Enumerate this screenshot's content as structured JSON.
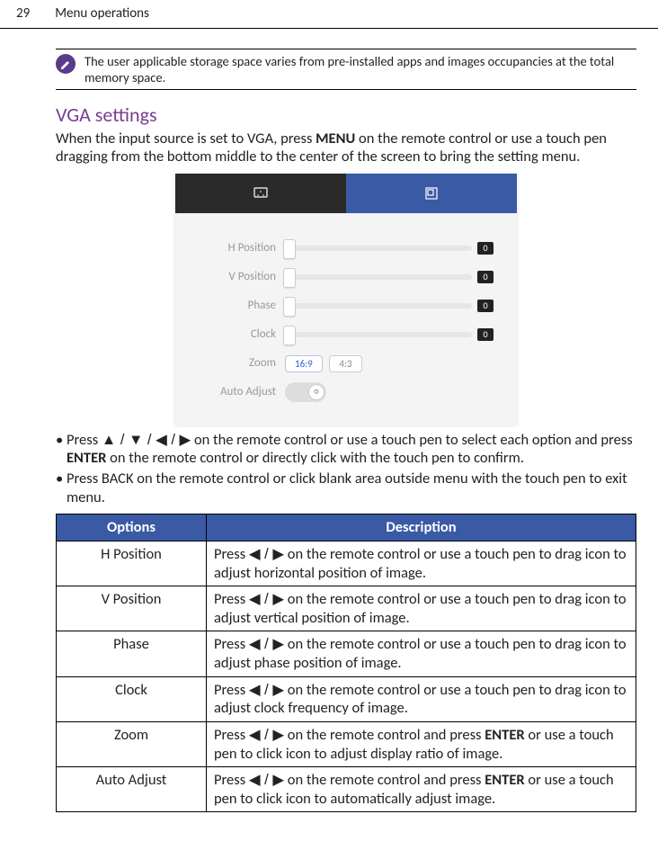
{
  "header": {
    "page_number": "29",
    "title": "Menu operations"
  },
  "note": {
    "text": "The user applicable storage space varies from pre-installed apps and images occupancies at the total memory space."
  },
  "section": {
    "title": "VGA settings",
    "intro_a": "When the input source is set to VGA, press ",
    "intro_menu": "MENU",
    "intro_b": " on the remote control or use a touch pen dragging from the bottom middle to the center of the screen to bring the setting menu."
  },
  "figure": {
    "rows": {
      "h_position": {
        "label": "H Position",
        "value": "0"
      },
      "v_position": {
        "label": "V Position",
        "value": "0"
      },
      "phase": {
        "label": "Phase",
        "value": "0"
      },
      "clock": {
        "label": "Clock",
        "value": "0"
      },
      "zoom": {
        "label": "Zoom",
        "opt_a": "16:9",
        "opt_b": "4:3"
      },
      "auto": {
        "label": "Auto Adjust"
      }
    }
  },
  "bullets": {
    "b1_a": "Press ",
    "arrows": "▲ / ▼ / ◀ / ▶",
    "b1_b": "  on the remote control or use a touch pen to select each option  and press ",
    "enter": "ENTER",
    "b1_c": " on the remote control or directly click with the touch pen to confirm.",
    "b2": "Press BACK on the remote control or click blank area outside menu with the touch pen to exit menu."
  },
  "table": {
    "head": {
      "options": "Options",
      "description": "Description"
    },
    "lr_arrows": "◀ / ▶",
    "enter": "ENTER",
    "rows": {
      "h_position": {
        "name": "H Position",
        "desc_a": "Press ",
        "desc_b": " on the remote control or use a touch pen to drag icon to adjust horizontal position of image."
      },
      "v_position": {
        "name": "V Position",
        "desc_a": "Press ",
        "desc_b": " on the remote control or use a touch pen to drag icon to adjust vertical position of image."
      },
      "phase": {
        "name": "Phase",
        "desc_a": "Press ",
        "desc_b": " on the remote control or use a touch pen to drag icon to adjust phase position of image."
      },
      "clock": {
        "name": "Clock",
        "desc_a": "Press ",
        "desc_b": " on the remote control or use a touch pen to drag icon to adjust clock frequency of image."
      },
      "zoom": {
        "name": "Zoom",
        "desc_a": "Press ",
        "desc_b": " on the remote control and press ",
        "desc_c": " or use a touch pen to click icon to adjust display ratio of image."
      },
      "auto_adjust": {
        "name": "Auto Adjust",
        "desc_a": "Press ",
        "desc_b": " on the remote control and press ",
        "desc_c": " or use a touch pen to click icon to automatically adjust image."
      }
    }
  }
}
